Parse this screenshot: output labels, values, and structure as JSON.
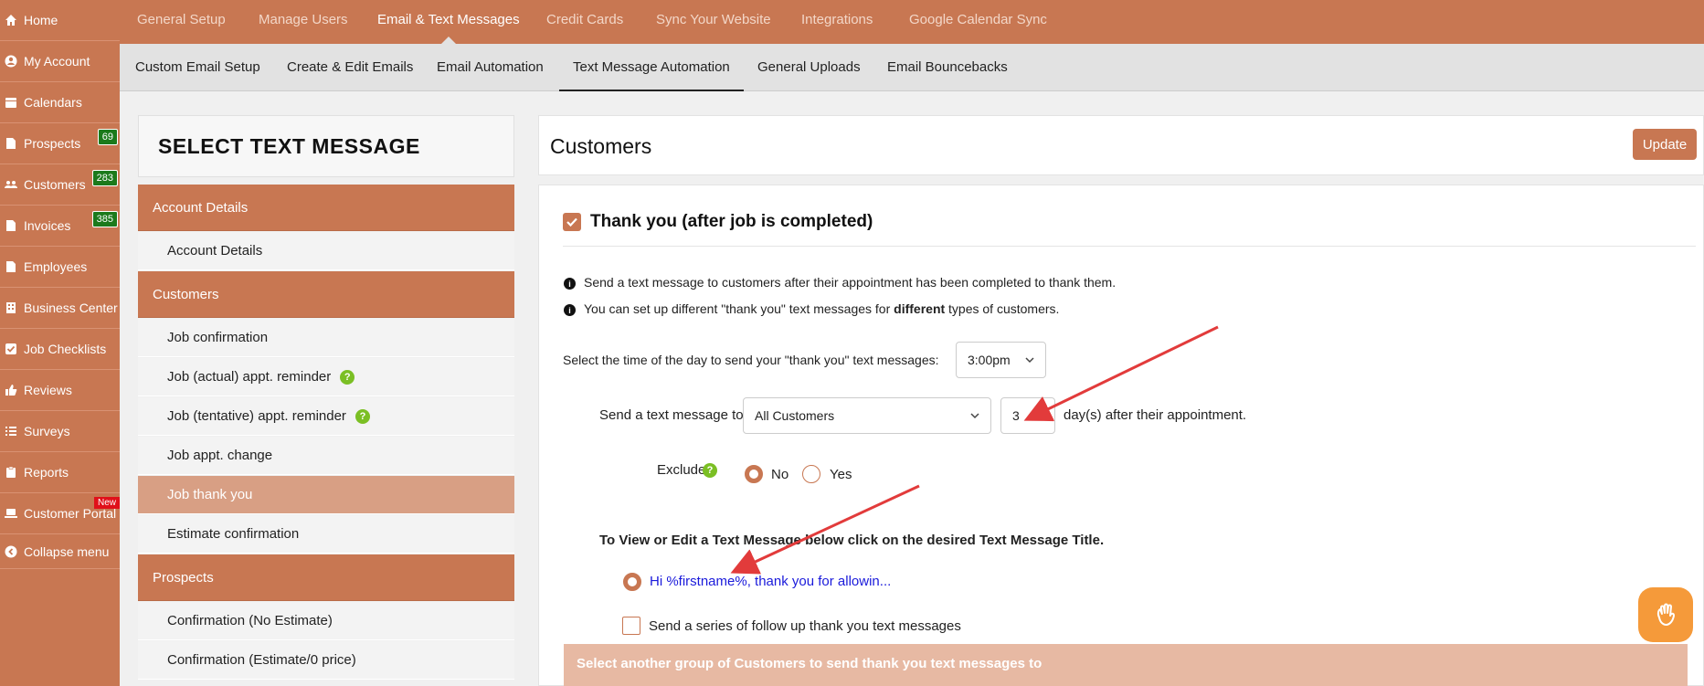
{
  "sidebar": {
    "items": [
      {
        "label": "Home",
        "icon": "home-icon"
      },
      {
        "label": "My Account",
        "icon": "user-icon"
      },
      {
        "label": "Calendars",
        "icon": "calendar-icon"
      },
      {
        "label": "Prospects",
        "icon": "file-icon",
        "badge": "69"
      },
      {
        "label": "Customers",
        "icon": "users-icon",
        "badge": "283"
      },
      {
        "label": "Invoices",
        "icon": "file-icon",
        "badge": "385"
      },
      {
        "label": "Employees",
        "icon": "file-icon"
      },
      {
        "label": "Business Center",
        "icon": "building-icon"
      },
      {
        "label": "Job Checklists",
        "icon": "checkbox-icon"
      },
      {
        "label": "Reviews",
        "icon": "thumbs-up-icon"
      },
      {
        "label": "Surveys",
        "icon": "list-icon"
      },
      {
        "label": "Reports",
        "icon": "clipboard-icon"
      },
      {
        "label": "Customer Portal",
        "icon": "laptop-icon",
        "badge_new": "New"
      },
      {
        "label": "Collapse menu",
        "icon": "chevron-left-circle-icon"
      }
    ]
  },
  "topnav": {
    "items": [
      "General Setup",
      "Manage Users",
      "Email & Text Messages",
      "Credit Cards",
      "Sync Your Website",
      "Integrations",
      "Google Calendar Sync"
    ],
    "active": "Email & Text Messages"
  },
  "subnav": {
    "items": [
      "Custom Email Setup",
      "Create & Edit Emails",
      "Email Automation",
      "Text Message Automation",
      "General Uploads",
      "Email Bouncebacks"
    ],
    "active": "Text Message Automation"
  },
  "left_panel": {
    "title": "SELECT TEXT MESSAGE",
    "rows": [
      {
        "type": "head",
        "label": "Account Details"
      },
      {
        "type": "sub",
        "label": "Account Details"
      },
      {
        "type": "head",
        "label": "Customers"
      },
      {
        "type": "sub",
        "label": "Job confirmation"
      },
      {
        "type": "sub",
        "label": "Job (actual) appt. reminder",
        "help": "?"
      },
      {
        "type": "sub",
        "label": "Job (tentative) appt. reminder",
        "help": "?"
      },
      {
        "type": "sub",
        "label": "Job appt. change"
      },
      {
        "type": "sub",
        "label": "Job thank you",
        "selected": true
      },
      {
        "type": "sub",
        "label": "Estimate confirmation"
      },
      {
        "type": "head",
        "label": "Prospects"
      },
      {
        "type": "sub",
        "label": "Confirmation (No Estimate)"
      },
      {
        "type": "sub",
        "label": "Confirmation (Estimate/0 price)"
      }
    ]
  },
  "right_panel": {
    "title": "Customers",
    "update_label": "Update",
    "section_title": "Thank you (after job is completed)",
    "info1": "Send a text message to customers after their appointment has been completed to thank them.",
    "info2_pre": "You can set up different \"thank you\" text messages for ",
    "info2_bold": "different",
    "info2_post": " types of customers.",
    "time_label": "Select the time of the day to send your \"thank you\" text messages:",
    "time_value": "3:00pm",
    "send_to_label": "Send a text message to",
    "send_to_value": "All Customers",
    "days_value": "3",
    "days_suffix": "day(s) after their appointment.",
    "exclude_label": "Exclude",
    "exclude_help": "?",
    "radio_no": "No",
    "radio_yes": "Yes",
    "view_edit_label": "To View or Edit a Text Message below click on the desired Text Message Title.",
    "message_link": "Hi %firstname%, thank you for allowin...",
    "series_label": "Send a series of follow up thank you text messages",
    "another_group": "Select another group of Customers to send thank you text messages to"
  },
  "colors": {
    "brand": "#c87752",
    "badge_green": "#1c7a1c",
    "arrow_red": "#e23b3b",
    "link_blue": "#1a1adb",
    "chat_orange": "#f59a3a"
  }
}
